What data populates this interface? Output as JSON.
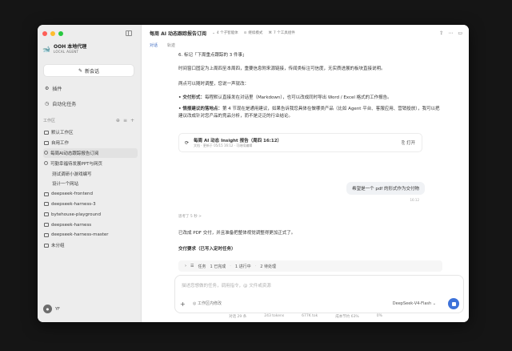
{
  "colors": {
    "accent": "#3d72d9",
    "tab_active": "#3f6cc1",
    "traffic_red": "#fe5f57",
    "traffic_yellow": "#febc2e",
    "traffic_green": "#28c840"
  },
  "sidebar": {
    "brand_name": "OOH 本地代理",
    "brand_sub": "LOCAL AGENT",
    "new_chat": "新会话",
    "nav": [
      {
        "label": "插件",
        "icon": "plugin-icon"
      },
      {
        "label": "自动化任务",
        "icon": "clock-icon"
      }
    ],
    "section_title": "工作区",
    "projects": [
      {
        "label": "默认工作区",
        "type": "folder"
      },
      {
        "label": "自用工作",
        "type": "folder"
      },
      {
        "label": "每周AI动态跟踪报告订阅",
        "type": "task",
        "meta": "",
        "highlight": true
      },
      {
        "label": "可勤幸福待发展PPT与网页",
        "type": "task",
        "meta": ""
      },
      {
        "label": "测试调研小游戏编写",
        "type": "sub",
        "meta": ""
      },
      {
        "label": "设计一个网站",
        "type": "sub",
        "meta": ""
      },
      {
        "label": "deepseek-frontend",
        "type": "folder"
      },
      {
        "label": "deepseek-harness-3",
        "type": "folder"
      },
      {
        "label": "bytehouse-playground",
        "type": "folder"
      },
      {
        "label": "deepseek-harness",
        "type": "folder"
      },
      {
        "label": "deepseek-harness-master",
        "type": "folder"
      },
      {
        "label": "未分组",
        "type": "folder"
      }
    ],
    "user_name": "YF"
  },
  "header": {
    "title": "每周 AI 动态跟踪报告订阅",
    "chips": [
      "4 个子智能体",
      "继续模式",
      "7 个工具组件"
    ]
  },
  "tabs": [
    "对话",
    "轨迹"
  ],
  "messages": {
    "line1": "6. 标记「下周重点跟踪的 3 件事」",
    "line2": "时间窗口固定为上周四至本周四，重要信息附来源链接，传闻类标注可信度，无实质进展的板块直接说明。",
    "line3": "两点可以随时调整，您说一声就改：",
    "bullet1_label": "• 交付形式：",
    "bullet1_text": "每程默认直接发在对话里（Markdown），也可以改成同时导出 Word / Excel 格式的工作报告。",
    "bullet2_label": "• 情报建议的落地点：",
    "bullet2_text": "第 4 节现在是通用建议，如果告诉我您具体在做哪类产品（比如 Agent 平台、客服应用、营销投放），我可以把建议改成针对您产品的竞品分析，而不是泛泛的行业结论。"
  },
  "artifact": {
    "title": "每周 AI 动态 Insight 报告（周四 16:12）",
    "subtitle": "文档 · 更新于 05/15 16:12 · 可继续编辑",
    "open": "打开"
  },
  "user_message": {
    "text": "希望是一个 pdf 的形式作为交付物",
    "meta": "16:12"
  },
  "thought": "思考了 5 秒 >",
  "reply": "已改成 PDF 交付，并且准备把整体视觉调整得更加正式了。",
  "delivery": "交付要求（已写入定时任务）",
  "tasks": {
    "label": "任务",
    "done": "1 已完成",
    "running": "1 进行中",
    "pending": "2 待处理"
  },
  "composer": {
    "placeholder": "描述您想做的任务，调用指令，@ 文件或资源",
    "mode": "工作区内修改",
    "model": "DeepSeek-V4-Flash"
  },
  "status": [
    "对话 29 条",
    "243 tokens",
    "677K tok",
    "成本节约 63%",
    "0%"
  ]
}
